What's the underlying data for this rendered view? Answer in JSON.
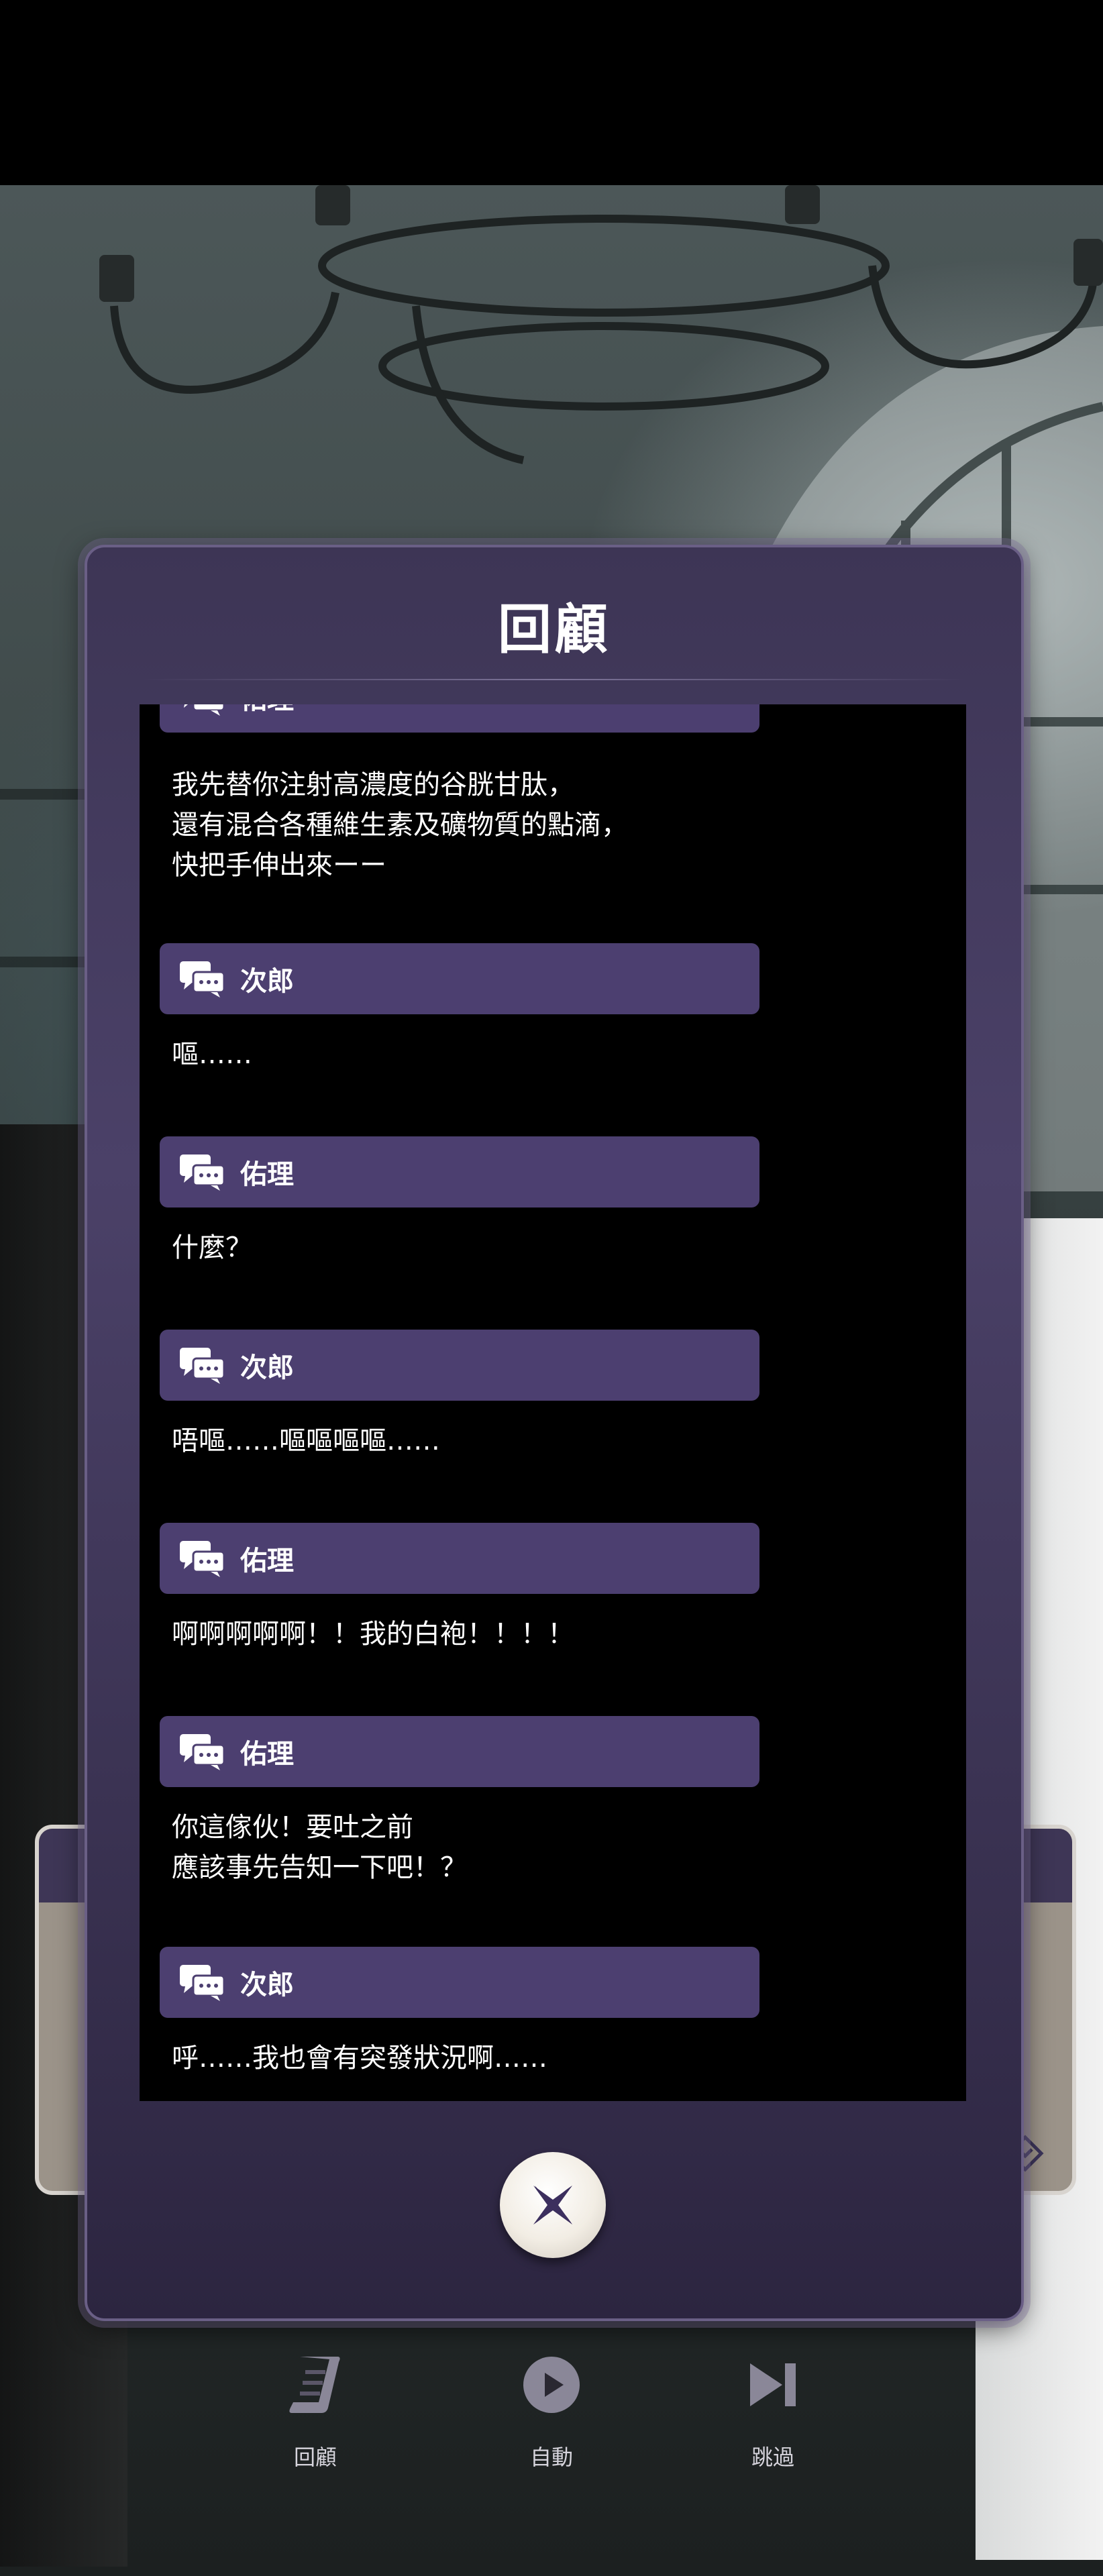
{
  "panel": {
    "title": "回顧",
    "close_label": "close"
  },
  "log": [
    {
      "speaker": "佑理",
      "text": "我先替你注射高濃度的谷胱甘肽，\n還有混合各種維生素及礦物質的點滴，\n快把手伸出來ーー"
    },
    {
      "speaker": "次郎",
      "text": "嘔……"
    },
    {
      "speaker": "佑理",
      "text": "什麼？"
    },
    {
      "speaker": "次郎",
      "text": "唔嘔……嘔嘔嘔嘔……"
    },
    {
      "speaker": "佑理",
      "text": "啊啊啊啊啊！！我的白袍！！！！"
    },
    {
      "speaker": "佑理",
      "text": "你這傢伙！要吐之前\n應該事先告知一下吧！？"
    },
    {
      "speaker": "次郎",
      "text": "呼……我也會有突發狀況啊……"
    }
  ],
  "controls": {
    "backlog_label": "回顧",
    "auto_label": "自動",
    "skip_label": "跳過"
  },
  "colors": {
    "panel": "#4b4168",
    "speaker_bar": "#4c3f70",
    "log_background": "#000000",
    "close_button": "#f2ede4",
    "close_icon": "#3c2f5e"
  },
  "icons": {
    "speaker": "chat-bubbles-icon",
    "close": "close-star-icon",
    "backlog": "scroll-icon",
    "auto": "play-icon",
    "skip": "skip-icon"
  }
}
